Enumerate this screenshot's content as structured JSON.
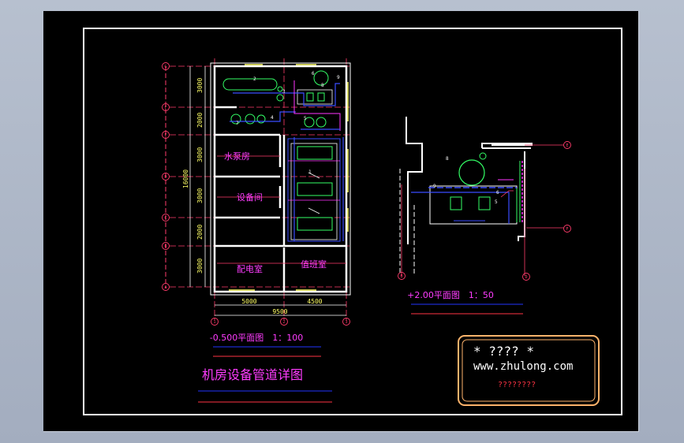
{
  "drawing": {
    "main_title": "机房设备管道详图",
    "plan_left": {
      "title": "-0.500平面图　1：100",
      "rooms": [
        "水泵房",
        "设备间",
        "配电室",
        "值班室"
      ],
      "dim_total": "16000",
      "dims_vertical": [
        "3000",
        "2000",
        "3000",
        "3000",
        "2000",
        "3000"
      ],
      "dims_horizontal": [
        "5000",
        "4500"
      ],
      "dim_horizontal_total": "9500",
      "grid_row_labels": [
        "G",
        "F",
        "E",
        "D",
        "C",
        "B",
        "A"
      ],
      "grid_col_labels": [
        "1",
        "2",
        "3"
      ],
      "equipment_tags": [
        "2",
        "3",
        "4",
        "5",
        "6",
        "7",
        "8",
        "9",
        "1"
      ]
    },
    "plan_right": {
      "title": "+2.00平面图　1：50",
      "grid_labels": [
        "E",
        "F",
        "B",
        "D"
      ],
      "equipment_tags": [
        "8",
        "9",
        "6",
        "5"
      ]
    },
    "stamp": {
      "line1": "* ???? *",
      "line2": "www.zhulong.com",
      "line3": "????????"
    }
  },
  "colors": {
    "background": "#000000",
    "border": "#ffffff",
    "wall": "#ffffff",
    "axis": "#ff3b6b",
    "dim_text": "#ffff66",
    "room_text": "#ff3cff",
    "pipe_blue": "#3a4dff",
    "pipe_green": "#33ff33",
    "pipe_magenta": "#ff33ff",
    "equipment": "#33ff66",
    "stamp_border": "#ffb36b",
    "stamp_url": "#ffffff",
    "stamp_red": "#ff3344",
    "title_underline_blue": "#2233ff",
    "title_underline_red": "#ff3344"
  }
}
